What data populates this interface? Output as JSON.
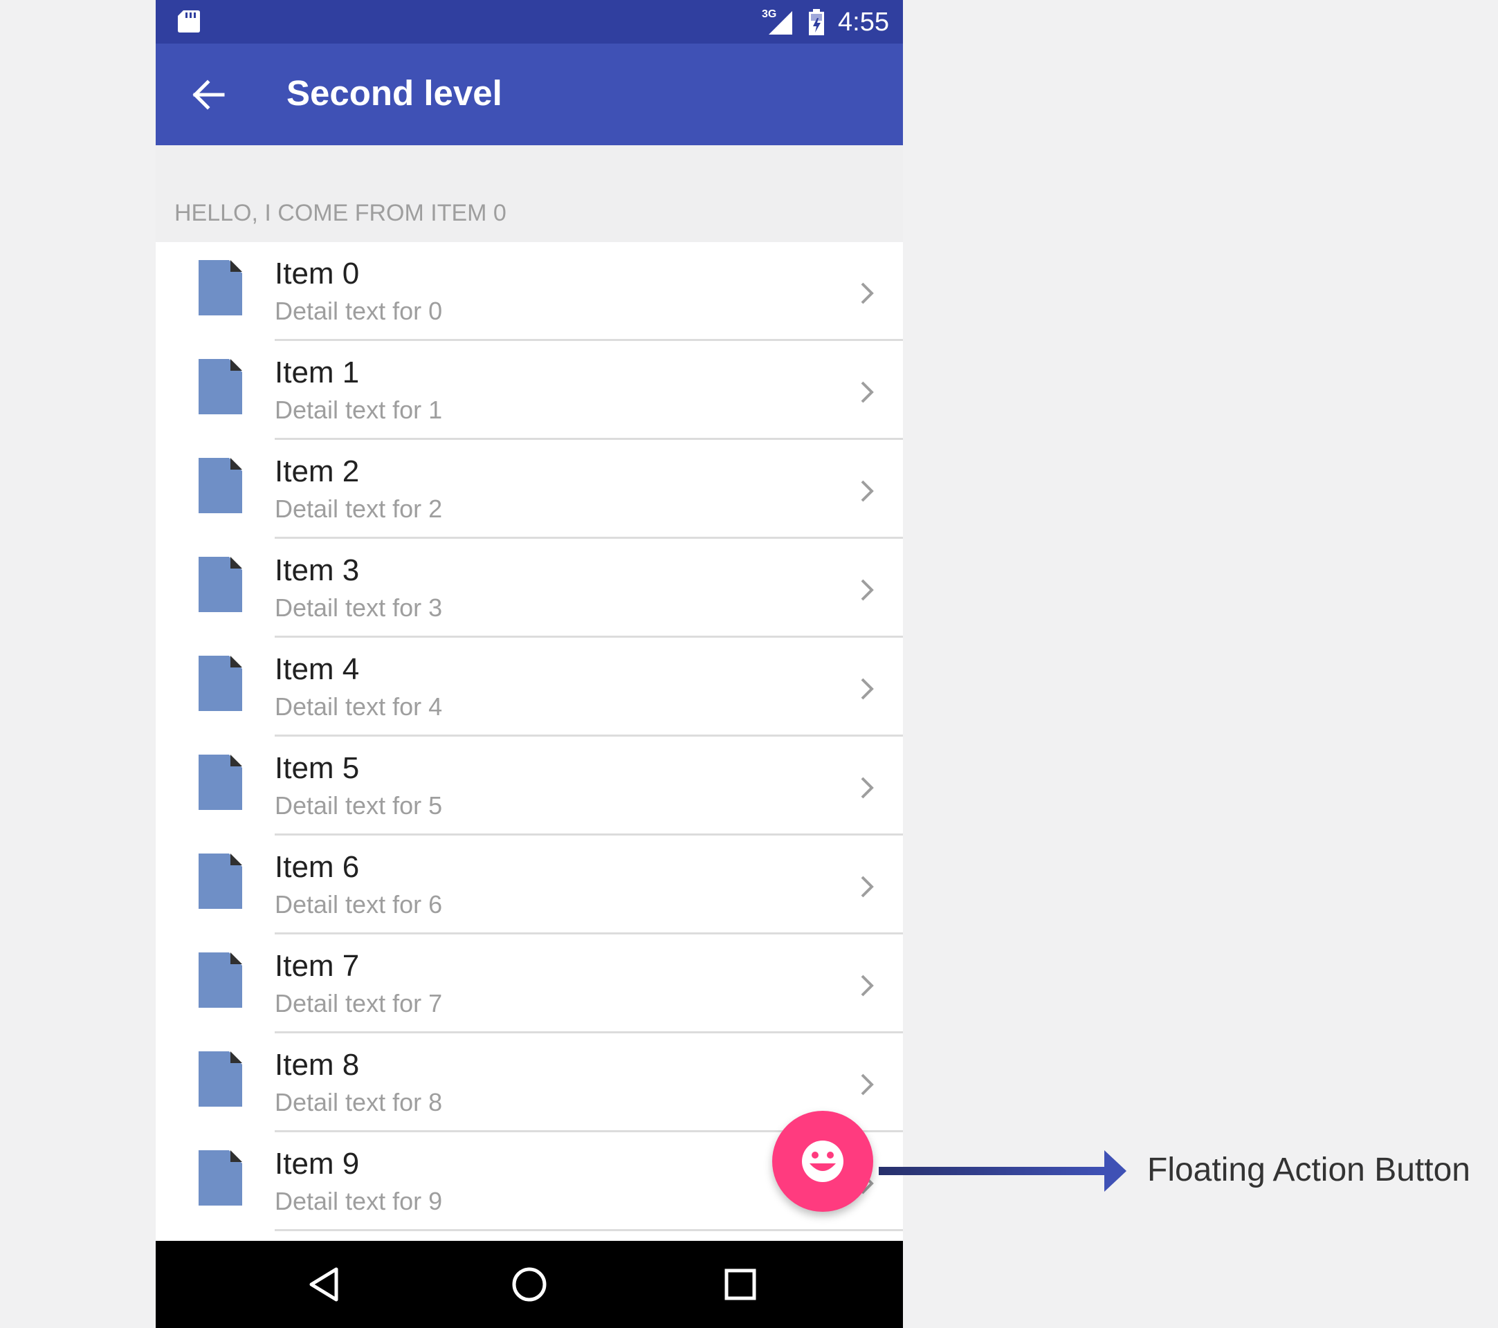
{
  "status_bar": {
    "network": "3G",
    "time": "4:55",
    "icons": [
      "sd-card-icon",
      "signal-icon",
      "battery-icon"
    ]
  },
  "app_bar": {
    "back_icon": "arrow-left-icon",
    "title": "Second level"
  },
  "subheader": "HELLO, I COME FROM ITEM 0",
  "list": {
    "item_icon": "document-icon",
    "trailing_icon": "chevron-right-icon",
    "items": [
      {
        "title": "Item 0",
        "detail": "Detail text for 0"
      },
      {
        "title": "Item 1",
        "detail": "Detail text for 1"
      },
      {
        "title": "Item 2",
        "detail": "Detail text for 2"
      },
      {
        "title": "Item 3",
        "detail": "Detail text for 3"
      },
      {
        "title": "Item 4",
        "detail": "Detail text for 4"
      },
      {
        "title": "Item 5",
        "detail": "Detail text for 5"
      },
      {
        "title": "Item 6",
        "detail": "Detail text for 6"
      },
      {
        "title": "Item 7",
        "detail": "Detail text for 7"
      },
      {
        "title": "Item 8",
        "detail": "Detail text for 8"
      },
      {
        "title": "Item 9",
        "detail": "Detail text for 9"
      }
    ]
  },
  "fab": {
    "icon": "smiley-icon",
    "color": "#ff3b7f"
  },
  "nav_bar": {
    "buttons": [
      "back-triangle-icon",
      "home-circle-icon",
      "recents-square-icon"
    ]
  },
  "annotation": {
    "label": "Floating Action Button",
    "arrow_color": "#3f51b5"
  },
  "colors": {
    "primary": "#3f51b5",
    "primary_dark": "#303f9f",
    "accent": "#ff3b7f",
    "doc_icon": "#6f8fc6"
  }
}
